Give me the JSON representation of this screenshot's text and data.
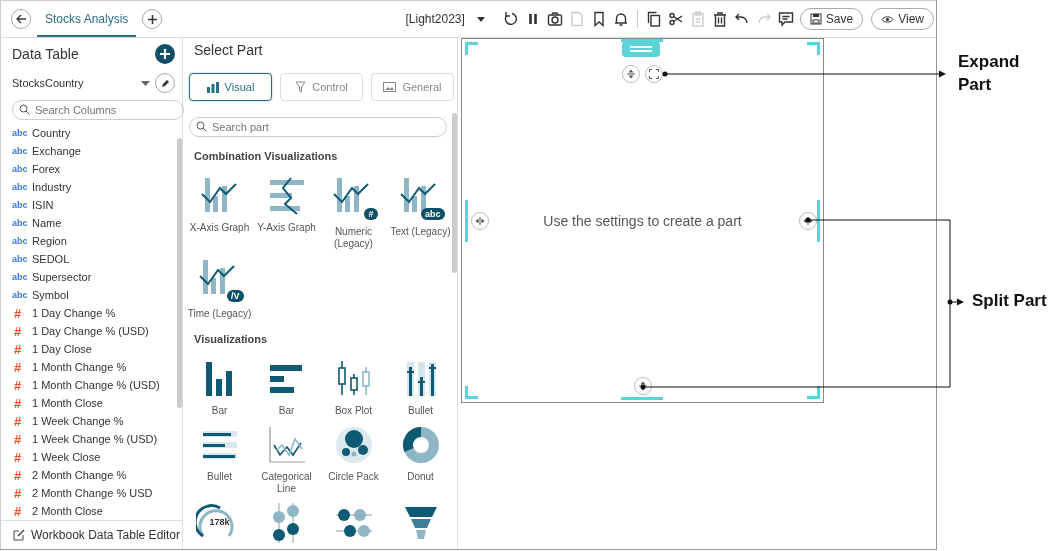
{
  "top_bar": {
    "tabs": [
      {
        "label": "Stocks Analysis",
        "selected": true
      }
    ],
    "theme": "[Light2023]",
    "buttons": [
      {
        "kind": "save",
        "label": "Save"
      },
      {
        "kind": "view",
        "label": "View"
      }
    ]
  },
  "data_table": {
    "title": "Data Table",
    "table": "StocksCountry",
    "search": {
      "placeholder": "Search Columns"
    },
    "columns": [
      {
        "kind": "text",
        "tag": "abc",
        "name": "Country"
      },
      {
        "kind": "text",
        "tag": "abc",
        "name": "Exchange"
      },
      {
        "kind": "text",
        "tag": "abc",
        "name": "Forex"
      },
      {
        "kind": "text",
        "tag": "abc",
        "name": "Industry"
      },
      {
        "kind": "text",
        "tag": "abc",
        "name": "ISIN"
      },
      {
        "kind": "text",
        "tag": "abc",
        "name": "Name"
      },
      {
        "kind": "text",
        "tag": "abc",
        "name": "Region"
      },
      {
        "kind": "text",
        "tag": "abc",
        "name": "SEDOL"
      },
      {
        "kind": "text",
        "tag": "abc",
        "name": "Supersector"
      },
      {
        "kind": "text",
        "tag": "abc",
        "name": "Symbol"
      },
      {
        "kind": "number",
        "tag": "#",
        "name": "1 Day Change %"
      },
      {
        "kind": "number",
        "tag": "#",
        "name": "1 Day Change % (USD)"
      },
      {
        "kind": "number",
        "tag": "#",
        "name": "1 Day Close"
      },
      {
        "kind": "number",
        "tag": "#",
        "name": "1 Month Change %"
      },
      {
        "kind": "number",
        "tag": "#",
        "name": "1 Month Change % (USD)"
      },
      {
        "kind": "number",
        "tag": "#",
        "name": "1 Month Close"
      },
      {
        "kind": "number",
        "tag": "#",
        "name": "1 Week Change %"
      },
      {
        "kind": "number",
        "tag": "#",
        "name": "1 Week Change % (USD)"
      },
      {
        "kind": "number",
        "tag": "#",
        "name": "1 Week Close"
      },
      {
        "kind": "number",
        "tag": "#",
        "name": "2 Month Change %"
      },
      {
        "kind": "number",
        "tag": "#",
        "name": "2 Month Change % USD"
      },
      {
        "kind": "number",
        "tag": "#",
        "name": "2 Month Close"
      }
    ],
    "footer": "Workbook Data Table Editor"
  },
  "select_part": {
    "title": "Select Part",
    "tabs": [
      {
        "kind": "visual",
        "label": "Visual",
        "selected": true
      },
      {
        "kind": "control",
        "label": "Control",
        "selected": false
      },
      {
        "kind": "general",
        "label": "General",
        "selected": false
      }
    ],
    "search": {
      "placeholder": "Search part"
    },
    "sections": [
      {
        "title": "Combination Visualizations",
        "items": [
          {
            "kind": "x-axis",
            "label": "X-Axis Graph"
          },
          {
            "kind": "y-axis",
            "label": "Y-Axis Graph"
          },
          {
            "kind": "combo-badge",
            "badge": "#",
            "label": "Numeric (Legacy)"
          },
          {
            "kind": "combo-badge",
            "badge": "abc",
            "label": "Text (Legacy)"
          },
          {
            "kind": "combo-badge",
            "badge": "/V",
            "label": "Time (Legacy)"
          }
        ]
      },
      {
        "title": "Visualizations",
        "items": [
          {
            "kind": "bar",
            "label": "Bar"
          },
          {
            "kind": "hbar",
            "label": "Bar"
          },
          {
            "kind": "box-plot",
            "label": "Box Plot"
          },
          {
            "kind": "bullet",
            "label": "Bullet"
          },
          {
            "kind": "hbullet",
            "label": "Bullet"
          },
          {
            "kind": "line",
            "label": "Categorical Line"
          },
          {
            "kind": "circle-pack",
            "label": "Circle Pack"
          },
          {
            "kind": "donut",
            "label": "Donut"
          },
          {
            "kind": "gauge",
            "badge": "178k"
          },
          {
            "kind": "dot-plot"
          },
          {
            "kind": "dumbbell"
          },
          {
            "kind": "funnel"
          }
        ]
      }
    ]
  },
  "canvas": {
    "message": "Use the settings to create a part"
  },
  "annotations": [
    {
      "kind": "expand",
      "label": "Expand Part"
    },
    {
      "kind": "split",
      "label": "Split Part"
    }
  ]
}
